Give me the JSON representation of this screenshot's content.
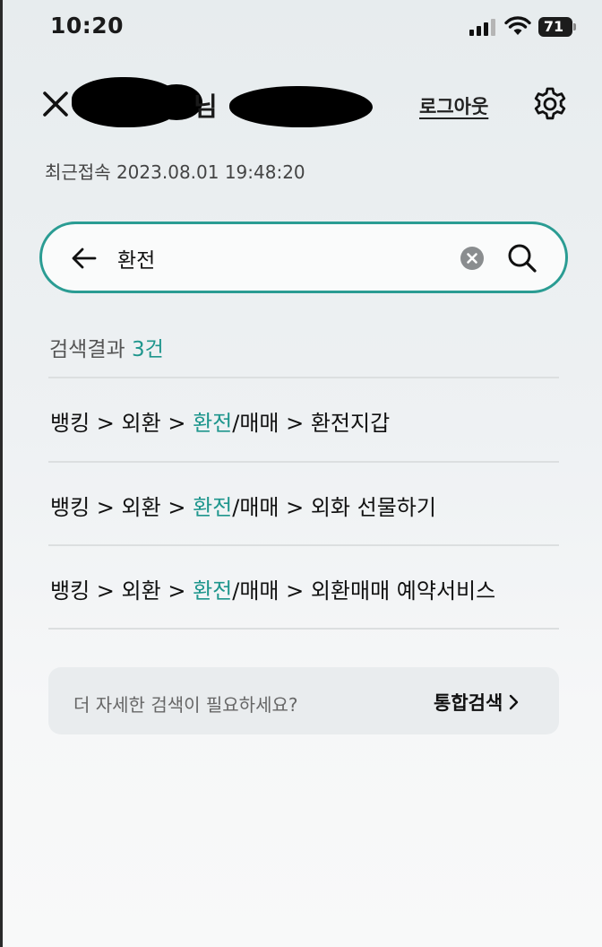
{
  "status_bar": {
    "time": "10:20",
    "battery": "71"
  },
  "header": {
    "greeting_suffix": "님",
    "logout_label": "로그아웃",
    "last_login": "최근접속 2023.08.01 19:48:20"
  },
  "search": {
    "value": "환전",
    "placeholder": ""
  },
  "results": {
    "count_label": "검색결과",
    "count": "3건",
    "items": [
      {
        "p1": "뱅킹 > 외환 > ",
        "highlight": "환전",
        "p2": "/매매 > 환전지갑"
      },
      {
        "p1": "뱅킹 > 외환 > ",
        "highlight": "환전",
        "p2": "/매매 > 외화 선물하기"
      },
      {
        "p1": "뱅킹 > 외환 > ",
        "highlight": "환전",
        "p2": "/매매 > 외환매매 예약서비스"
      }
    ]
  },
  "more_search": {
    "text": "더 자세한 검색이 필요하세요?",
    "link_label": "통합검색"
  },
  "colors": {
    "accent": "#1f968d",
    "search_border": "#2a9c93"
  }
}
